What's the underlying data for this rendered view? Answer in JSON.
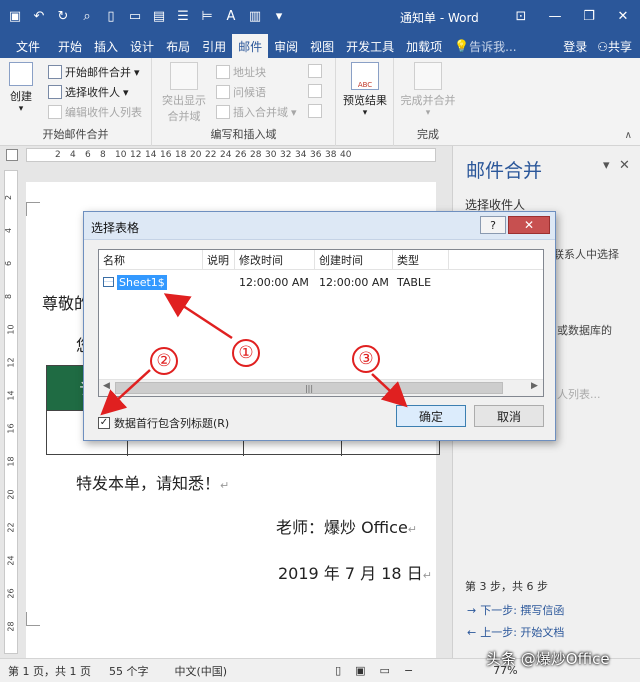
{
  "titlebar": {
    "title": "通知单 - Word",
    "qat_icons": [
      "save-icon",
      "undo-icon",
      "redo-icon",
      "print-preview-icon",
      "new-doc-icon",
      "open-icon",
      "paste-icon"
    ]
  },
  "tabs": {
    "file": "文件",
    "items": [
      "开始",
      "插入",
      "设计",
      "布局",
      "引用",
      "邮件",
      "审阅",
      "视图",
      "开发工具",
      "加载项"
    ],
    "active": "邮件",
    "tell_me": "告诉我...",
    "login": "登录",
    "share": "共享"
  },
  "ribbon": {
    "create": "创建",
    "start_merge": "开始邮件合并",
    "select_recipients": "选择收件人",
    "edit_recipients": "编辑收件人列表",
    "group1": "开始邮件合并",
    "highlight_fields": "突出显示\n合并域",
    "address_block": "地址块",
    "greeting": "问候语",
    "insert_field": "插入合并域",
    "group2": "编写和插入域",
    "preview_results": "预览结果",
    "finish_merge": "完成并合并",
    "group3": "完成",
    "abc_label": "ABC"
  },
  "ruler": {
    "ticks": [
      "2",
      "4",
      "6",
      "8",
      "10",
      "12",
      "14",
      "16",
      "18",
      "20",
      "22",
      "24",
      "26",
      "28",
      "30",
      "32",
      "34",
      "36",
      "38",
      "40"
    ],
    "vticks": [
      "2",
      "4",
      "6",
      "8",
      "10",
      "12",
      "14",
      "16",
      "18",
      "20",
      "22",
      "24",
      "26",
      "28"
    ]
  },
  "document": {
    "greeting_partial": "尊敬的",
    "line2_partial": "您",
    "table_header_partial": "讠",
    "notice": "特发本单，请知悉！",
    "signature": "老师：爆炒 Office",
    "date": "2019 年 7 月 18 日",
    "para_mark": "↵"
  },
  "pane": {
    "title": "邮件合并",
    "subtitle": "选择收件人",
    "frag1": "联系人中选择",
    "frag2": "或数据库的",
    "frag3": "人列表...",
    "step": "第 3 步，共 6 步",
    "next": "下一步: 撰写信函",
    "prev": "上一步: 开始文档"
  },
  "statusbar": {
    "page": "第 1 页，共 1 页",
    "words": "55 个字",
    "lang": "中文(中国)",
    "zoom": "77%"
  },
  "dialog": {
    "title": "选择表格",
    "help": "?",
    "close": "✕",
    "columns": [
      "名称",
      "说明",
      "修改时间",
      "创建时间",
      "类型"
    ],
    "row": {
      "name": "Sheet1$",
      "desc": "",
      "modified": "12:00:00 AM",
      "created": "12:00:00 AM",
      "type": "TABLE"
    },
    "checkbox_label": "数据首行包含列标题(R)",
    "checkbox_checked": true,
    "ok": "确定",
    "cancel": "取消",
    "scroll_grip": "|||"
  },
  "annotations": {
    "c1": "①",
    "c2": "②",
    "c3": "③",
    "color": "#e02020"
  },
  "watermark": "头条 @爆炒Office"
}
